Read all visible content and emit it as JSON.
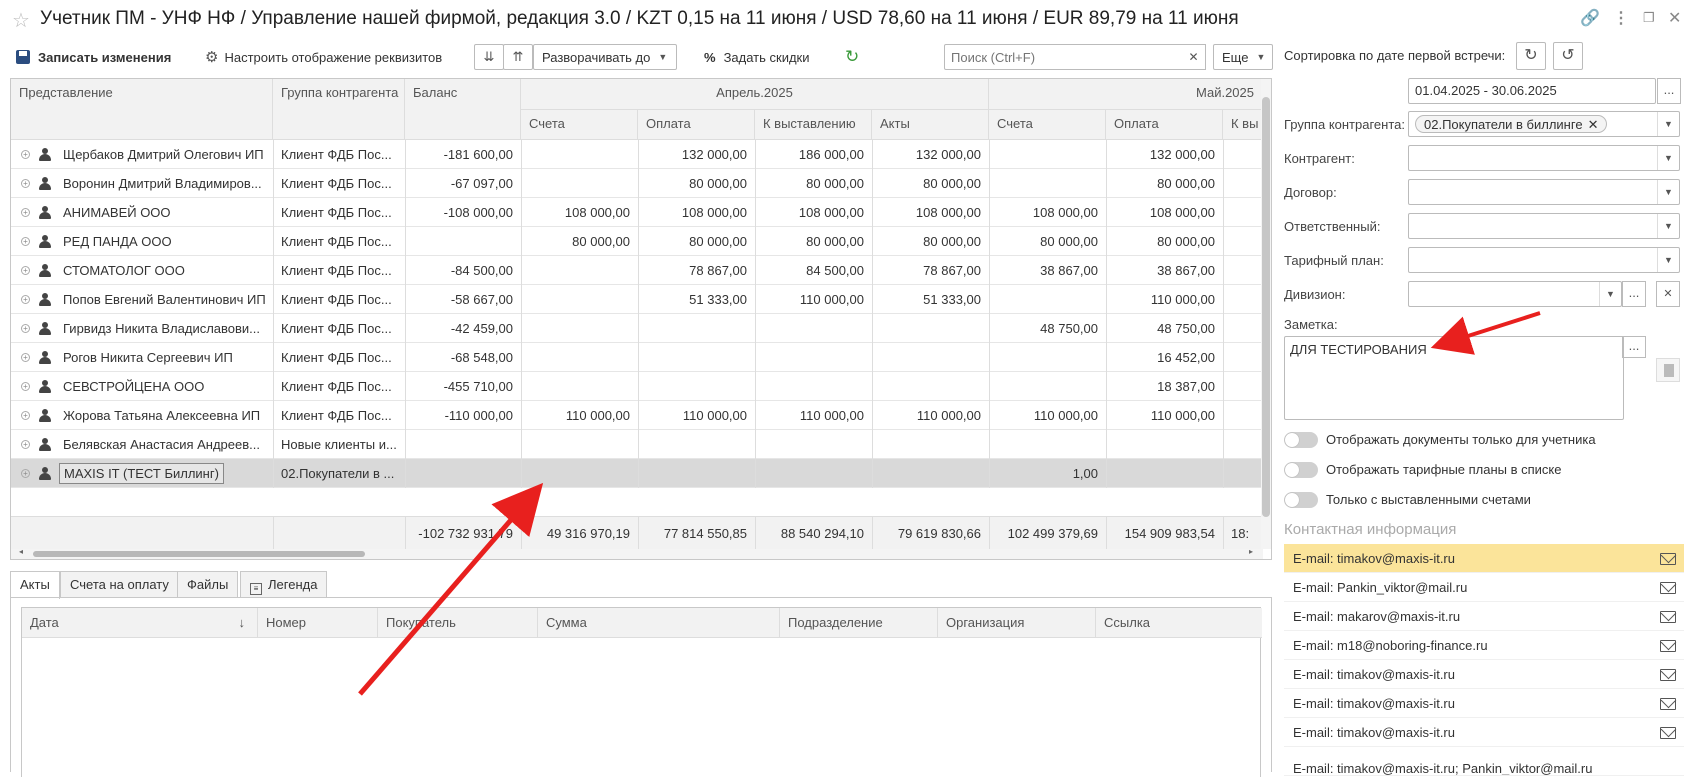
{
  "window": {
    "title": "Учетник ПМ - УНФ НФ / Управление нашей фирмой, редакция 3.0 / KZT 0,15 на 11 июня / USD 78,60 на 11 июня / EUR 89,79 на 11 июня"
  },
  "toolbar": {
    "save_label": "Записать изменения",
    "configure_label": "Настроить отображение реквизитов",
    "expand_label": "Разворачивать до",
    "discounts_label": "Задать скидки",
    "search_placeholder": "Поиск (Ctrl+F)",
    "more_label": "Еще",
    "sort_label": "Сортировка по дате первой встречи:"
  },
  "grid": {
    "col_headers": {
      "name": "Представление",
      "group": "Группа контрагента",
      "balance": "Баланс",
      "month1": "Апрель.2025",
      "month2": "Май.2025",
      "sub1": "Счета",
      "sub2": "Оплата",
      "sub3": "К выставлению",
      "sub4": "Акты",
      "sub5": "Счета",
      "sub6": "Оплата",
      "sub7": "К вы"
    },
    "rows": [
      {
        "name": "Щербаков Дмитрий Олегович ИП",
        "group": "Клиент ФДБ Пос...",
        "balance": "-181 600,00",
        "c1": "",
        "c2": "132 000,00",
        "c3": "186 000,00",
        "c4": "132 000,00",
        "c5": "",
        "c6": "132 000,00"
      },
      {
        "name": "Воронин Дмитрий Владимиров...",
        "group": "Клиент ФДБ Пос...",
        "balance": "-67 097,00",
        "c1": "",
        "c2": "80 000,00",
        "c3": "80 000,00",
        "c4": "80 000,00",
        "c5": "",
        "c6": "80 000,00"
      },
      {
        "name": "АНИМАВЕЙ ООО",
        "group": "Клиент ФДБ Пос...",
        "balance": "-108 000,00",
        "c1": "108 000,00",
        "c2": "108 000,00",
        "c3": "108 000,00",
        "c4": "108 000,00",
        "c5": "108 000,00",
        "c6": "108 000,00"
      },
      {
        "name": "РЕД ПАНДА ООО",
        "group": "Клиент ФДБ Пос...",
        "balance": "",
        "c1": "80 000,00",
        "c2": "80 000,00",
        "c3": "80 000,00",
        "c4": "80 000,00",
        "c5": "80 000,00",
        "c6": "80 000,00"
      },
      {
        "name": "СТОМАТОЛОГ ООО",
        "group": "Клиент ФДБ Пос...",
        "balance": "-84 500,00",
        "c1": "",
        "c2": "78 867,00",
        "c3": "84 500,00",
        "c4": "78 867,00",
        "c5": "38 867,00",
        "c6": "38 867,00"
      },
      {
        "name": "Попов Евгений Валентинович ИП",
        "group": "Клиент ФДБ Пос...",
        "balance": "-58 667,00",
        "c1": "",
        "c2": "51 333,00",
        "c3": "110 000,00",
        "c4": "51 333,00",
        "c5": "",
        "c6": "110 000,00"
      },
      {
        "name": "Гирвидз Никита Владиславови...",
        "group": "Клиент ФДБ Пос...",
        "balance": "-42 459,00",
        "c1": "",
        "c2": "",
        "c3": "",
        "c4": "",
        "c5": "48 750,00",
        "c6": "48 750,00"
      },
      {
        "name": "Рогов Никита Сергеевич ИП",
        "group": "Клиент ФДБ Пос...",
        "balance": "-68 548,00",
        "c1": "",
        "c2": "",
        "c3": "",
        "c4": "",
        "c5": "",
        "c6": "16 452,00"
      },
      {
        "name": "СЕВСТРОЙЦЕНА ООО",
        "group": "Клиент ФДБ Пос...",
        "balance": "-455 710,00",
        "c1": "",
        "c2": "",
        "c3": "",
        "c4": "",
        "c5": "",
        "c6": "18 387,00"
      },
      {
        "name": "Жорова Татьяна Алексеевна ИП",
        "group": "Клиент ФДБ Пос...",
        "balance": "-110 000,00",
        "c1": "110 000,00",
        "c2": "110 000,00",
        "c3": "110 000,00",
        "c4": "110 000,00",
        "c5": "110 000,00",
        "c6": "110 000,00"
      },
      {
        "name": "Белявская Анастасия Андреев...",
        "group": "Новые клиенты и...",
        "balance": "",
        "c1": "",
        "c2": "",
        "c3": "",
        "c4": "",
        "c5": "",
        "c6": ""
      },
      {
        "name": "MAXIS IT (ТЕСТ Биллинг)",
        "group": "02.Покупатели в ...",
        "balance": "",
        "c1": "",
        "c2": "",
        "c3": "",
        "c4": "",
        "c5": "1,00",
        "c6": ""
      }
    ],
    "totals": {
      "balance": "-102 732 931,79",
      "c1": "49 316 970,19",
      "c2": "77 814 550,85",
      "c3": "88 540 294,10",
      "c4": "79 619 830,66",
      "c5": "102 499 379,69",
      "c6": "154 909 983,54",
      "c7": "18:"
    }
  },
  "tabs": [
    "Акты",
    "Счета на оплату",
    "Файлы",
    "Легенда"
  ],
  "subgrid_headers": [
    "Дата",
    "Номер",
    "Покупатель",
    "Сумма",
    "Подразделение",
    "Организация",
    "Ссылка"
  ],
  "filters": {
    "period_value": "01.04.2025 - 30.06.2025",
    "group_label": "Группа контрагента:",
    "group_chip": "02.Покупатели в биллинге",
    "counterparty_label": "Контрагент:",
    "contract_label": "Договор:",
    "responsible_label": "Ответственный:",
    "tariff_label": "Тарифный план:",
    "division_label": "Дивизион:",
    "note_label": "Заметка:",
    "note_value": "ДЛЯ ТЕСТИРОВАНИЯ"
  },
  "toggles": [
    "Отображать документы только для учетника",
    "Отображать тарифные планы в списке",
    "Только с выставленными счетами"
  ],
  "contacts": {
    "title": "Контактная информация",
    "items": [
      "E-mail: timakov@maxis-it.ru",
      "E-mail: Pankin_viktor@mail.ru",
      "E-mail: makarov@maxis-it.ru",
      "E-mail: m18@noboring-finance.ru",
      "E-mail: timakov@maxis-it.ru",
      "E-mail: timakov@maxis-it.ru",
      "E-mail: timakov@maxis-it.ru",
      "E-mail: timakov@maxis-it.ru; Pankin_viktor@mail.ru"
    ]
  },
  "colors": {
    "highlight": "#fbe49a",
    "arrow": "#e8201e",
    "refresh": "#3a9a3a"
  }
}
